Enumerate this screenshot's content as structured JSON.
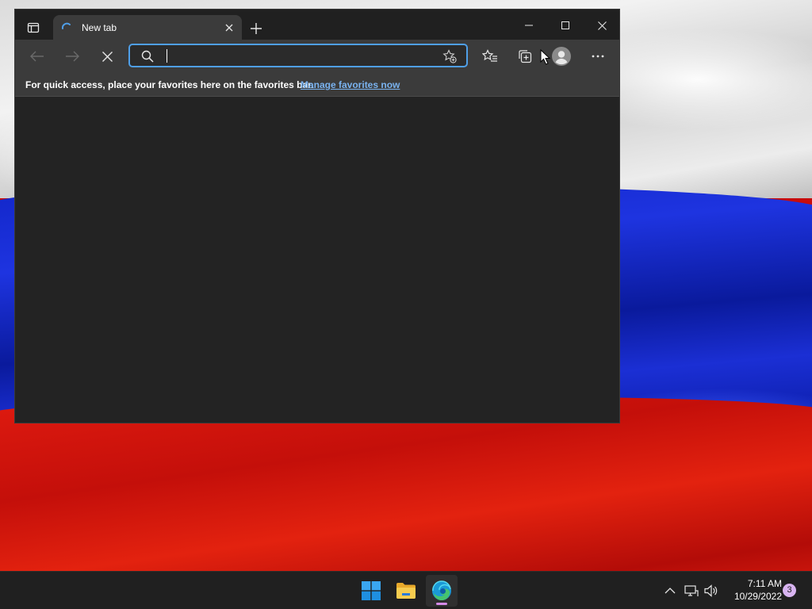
{
  "browser": {
    "tab": {
      "title": "New tab"
    },
    "address_bar": {
      "value": "",
      "placeholder": ""
    },
    "favorites_bar": {
      "message": "For quick access, place your favorites here on the favorites bar.",
      "link": "Manage favorites now"
    }
  },
  "taskbar": {
    "clock": {
      "time": "7:11 AM",
      "date": "10/29/2022"
    },
    "notification_count": "3"
  },
  "colors": {
    "accent": "#4f9fe8",
    "link": "#7ab3f0",
    "window_bg": "#202020",
    "toolbar_bg": "#3b3b3b",
    "active_indicator": "#d58ae8"
  },
  "icons": [
    "tab-actions-icon",
    "loading-spinner-icon",
    "close-icon",
    "plus-icon",
    "minimize-icon",
    "maximize-icon",
    "back-arrow-icon",
    "forward-arrow-icon",
    "stop-icon",
    "search-icon",
    "add-favorite-icon",
    "favorites-icon",
    "collections-icon",
    "profile-icon",
    "more-icon",
    "windows-start-icon",
    "file-explorer-icon",
    "edge-icon",
    "chevron-up-icon",
    "network-icon",
    "volume-icon",
    "mouse-cursor-icon"
  ]
}
